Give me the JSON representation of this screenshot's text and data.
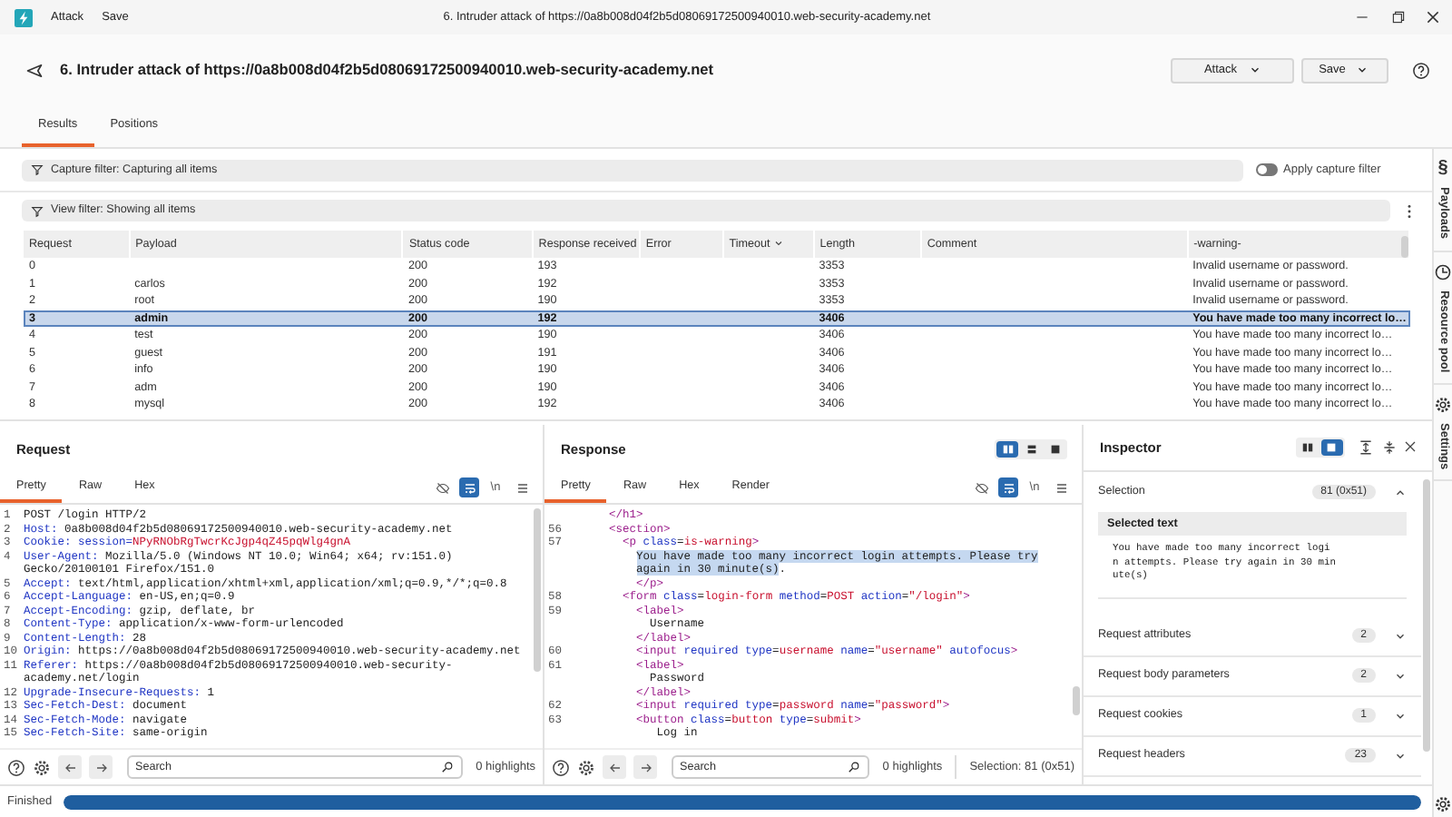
{
  "titlebar": {
    "menu": [
      "Attack",
      "Save"
    ],
    "title": "6. Intruder attack of https://0a8b008d04f2b5d08069172500940010.web-security-academy.net"
  },
  "header": {
    "title": "6. Intruder attack of https://0a8b008d04f2b5d08069172500940010.web-security-academy.net",
    "buttons": [
      "Attack",
      "Save"
    ]
  },
  "tabs": [
    {
      "label": "Results",
      "selected": true
    },
    {
      "label": "Positions",
      "selected": false
    }
  ],
  "capture_filter": {
    "label": "Capture filter: Capturing all items",
    "toggle_label": "Apply capture filter",
    "on": false
  },
  "view_filter": {
    "label": "View filter: Showing all items"
  },
  "table": {
    "columns": [
      {
        "label": "Request",
        "sorted": false
      },
      {
        "label": "Payload",
        "sorted": false
      },
      {
        "label": "Status code",
        "sorted": false
      },
      {
        "label": "Response received",
        "sorted": false
      },
      {
        "label": "Error",
        "sorted": false
      },
      {
        "label": "Timeout",
        "sorted": true
      },
      {
        "label": "Length",
        "sorted": false
      },
      {
        "label": "Comment",
        "sorted": false
      },
      {
        "label": "-warning-",
        "sorted": false
      }
    ],
    "rows": [
      {
        "selected": false,
        "cells": [
          "0",
          "",
          "200",
          "193",
          "",
          "",
          "3353",
          "",
          "Invalid username or password."
        ]
      },
      {
        "selected": false,
        "cells": [
          "1",
          "carlos",
          "200",
          "192",
          "",
          "",
          "3353",
          "",
          "Invalid username or password."
        ]
      },
      {
        "selected": false,
        "cells": [
          "2",
          "root",
          "200",
          "190",
          "",
          "",
          "3353",
          "",
          "Invalid username or password."
        ]
      },
      {
        "selected": true,
        "cells": [
          "3",
          "admin",
          "200",
          "192",
          "",
          "",
          "3406",
          "",
          "You have made too many incorrect lo…"
        ]
      },
      {
        "selected": false,
        "cells": [
          "4",
          "test",
          "200",
          "190",
          "",
          "",
          "3406",
          "",
          "You have made too many incorrect lo…"
        ]
      },
      {
        "selected": false,
        "cells": [
          "5",
          "guest",
          "200",
          "191",
          "",
          "",
          "3406",
          "",
          "You have made too many incorrect lo…"
        ]
      },
      {
        "selected": false,
        "cells": [
          "6",
          "info",
          "200",
          "190",
          "",
          "",
          "3406",
          "",
          "You have made too many incorrect lo…"
        ]
      },
      {
        "selected": false,
        "cells": [
          "7",
          "adm",
          "200",
          "190",
          "",
          "",
          "3406",
          "",
          "You have made too many incorrect lo…"
        ]
      },
      {
        "selected": false,
        "cells": [
          "8",
          "mysql",
          "200",
          "192",
          "",
          "",
          "3406",
          "",
          "You have made too many incorrect lo…"
        ]
      }
    ]
  },
  "request": {
    "title": "Request",
    "tabs": [
      {
        "label": "Pretty",
        "selected": true
      },
      {
        "label": "Raw",
        "selected": false
      },
      {
        "label": "Hex",
        "selected": false
      }
    ],
    "tools": [
      {
        "kind": "hide",
        "selected": false
      },
      {
        "kind": "wrap",
        "selected": true
      },
      {
        "kind": "newline",
        "label": "\\n",
        "selected": false
      },
      {
        "kind": "menu",
        "selected": false
      }
    ],
    "lines": [
      {
        "number": "1",
        "parts": [
          {
            "kind": "plain",
            "text": "POST /login HTTP/2"
          }
        ]
      },
      {
        "number": "2",
        "parts": [
          {
            "kind": "key",
            "text": "Host:"
          },
          {
            "kind": "plain",
            "text": " 0a8b008d04f2b5d08069172500940010.web-security-academy.net"
          }
        ]
      },
      {
        "number": "3",
        "parts": [
          {
            "kind": "key",
            "text": "Cookie: session="
          },
          {
            "kind": "cookie",
            "text": "NPyRNObRgTwcrKcJgp4qZ45pqWlg4gnA"
          }
        ]
      },
      {
        "number": "4",
        "parts": [
          {
            "kind": "key",
            "text": "User-Agent:"
          },
          {
            "kind": "plain",
            "text": " Mozilla/5.0 (Windows NT 10.0; Win64; x64; rv:151.0) Gecko/20100101 Firefox/151.0"
          }
        ]
      },
      {
        "number": "5",
        "parts": [
          {
            "kind": "key",
            "text": "Accept:"
          },
          {
            "kind": "plain",
            "text": " text/html,application/xhtml+xml,application/xml;q=0.9,*/*;q=0.8"
          }
        ]
      },
      {
        "number": "6",
        "parts": [
          {
            "kind": "key",
            "text": "Accept-Language:"
          },
          {
            "kind": "plain",
            "text": " en-US,en;q=0.9"
          }
        ]
      },
      {
        "number": "7",
        "parts": [
          {
            "kind": "key",
            "text": "Accept-Encoding:"
          },
          {
            "kind": "plain",
            "text": " gzip, deflate, br"
          }
        ]
      },
      {
        "number": "8",
        "parts": [
          {
            "kind": "key",
            "text": "Content-Type:"
          },
          {
            "kind": "plain",
            "text": " application/x-www-form-urlencoded"
          }
        ]
      },
      {
        "number": "9",
        "parts": [
          {
            "kind": "key",
            "text": "Content-Length:"
          },
          {
            "kind": "plain",
            "text": " 28"
          }
        ]
      },
      {
        "number": "10",
        "parts": [
          {
            "kind": "key",
            "text": "Origin:"
          },
          {
            "kind": "plain",
            "text": " https://0a8b008d04f2b5d08069172500940010.web-security-academy.net"
          }
        ]
      },
      {
        "number": "11",
        "parts": [
          {
            "kind": "key",
            "text": "Referer:"
          },
          {
            "kind": "plain",
            "text": " https://0a8b008d04f2b5d08069172500940010.web-security-academy.net/login"
          }
        ]
      },
      {
        "number": "12",
        "parts": [
          {
            "kind": "key",
            "text": "Upgrade-Insecure-Requests:"
          },
          {
            "kind": "plain",
            "text": " 1"
          }
        ]
      },
      {
        "number": "13",
        "parts": [
          {
            "kind": "key",
            "text": "Sec-Fetch-Dest:"
          },
          {
            "kind": "plain",
            "text": " document"
          }
        ]
      },
      {
        "number": "14",
        "parts": [
          {
            "kind": "key",
            "text": "Sec-Fetch-Mode:"
          },
          {
            "kind": "plain",
            "text": " navigate"
          }
        ]
      },
      {
        "number": "15",
        "parts": [
          {
            "kind": "key",
            "text": "Sec-Fetch-Site:"
          },
          {
            "kind": "plain",
            "text": " same-origin"
          }
        ]
      }
    ],
    "search": {
      "placeholder": "Search"
    },
    "highlights": "0 highlights"
  },
  "response": {
    "title": "Response",
    "tabs": [
      {
        "label": "Pretty",
        "selected": true
      },
      {
        "label": "Raw",
        "selected": false
      },
      {
        "label": "Hex",
        "selected": false
      },
      {
        "label": "Render",
        "selected": false
      }
    ],
    "views": [
      {
        "kind": "split",
        "selected": true
      },
      {
        "kind": "rows",
        "selected": false
      },
      {
        "kind": "single",
        "selected": false
      }
    ],
    "tools": [
      {
        "kind": "hide",
        "selected": false
      },
      {
        "kind": "wrap",
        "selected": true
      },
      {
        "kind": "newline",
        "label": "\\n",
        "selected": false
      },
      {
        "kind": "menu",
        "selected": false
      }
    ],
    "lines": [
      {
        "parts": [
          {
            "kind": "tag",
            "text": "      </h1>"
          }
        ]
      },
      {
        "number": "56",
        "parts": [
          {
            "kind": "tag",
            "text": "      <section>"
          }
        ]
      },
      {
        "number": "57",
        "parts": [
          {
            "kind": "tag",
            "text": "        <p "
          },
          {
            "kind": "attr",
            "text": "class"
          },
          {
            "kind": "plain",
            "text": "="
          },
          {
            "kind": "value",
            "text": "is-warning"
          },
          {
            "kind": "tag",
            "text": ">"
          }
        ]
      },
      {
        "parts": [
          {
            "kind": "selection",
            "text": "          You have made too many incorrect login attempts. Please try"
          }
        ]
      },
      {
        "parts": [
          {
            "kind": "selection",
            "text": "          again in 30 minute(s)"
          },
          {
            "kind": "plain",
            "text": "."
          }
        ]
      },
      {
        "parts": [
          {
            "kind": "tag",
            "text": "          </p>"
          }
        ]
      },
      {
        "number": "58",
        "parts": [
          {
            "kind": "tag",
            "text": "        <form "
          },
          {
            "kind": "attr",
            "text": "class"
          },
          {
            "kind": "plain",
            "text": "="
          },
          {
            "kind": "value",
            "text": "login-form"
          },
          {
            "kind": "attr",
            "text": " method"
          },
          {
            "kind": "plain",
            "text": "="
          },
          {
            "kind": "value",
            "text": "POST"
          },
          {
            "kind": "attr",
            "text": " action"
          },
          {
            "kind": "plain",
            "text": "="
          },
          {
            "kind": "value",
            "text": "\"/login\""
          },
          {
            "kind": "tag",
            "text": ">"
          }
        ]
      },
      {
        "number": "59",
        "parts": [
          {
            "kind": "tag",
            "text": "          <label>"
          }
        ]
      },
      {
        "parts": [
          {
            "kind": "plain",
            "text": "            Username"
          }
        ]
      },
      {
        "parts": [
          {
            "kind": "tag",
            "text": "          </label>"
          }
        ]
      },
      {
        "number": "60",
        "parts": [
          {
            "kind": "tag",
            "text": "          <input "
          },
          {
            "kind": "attr",
            "text": "required type"
          },
          {
            "kind": "plain",
            "text": "="
          },
          {
            "kind": "value",
            "text": "username"
          },
          {
            "kind": "attr",
            "text": " name"
          },
          {
            "kind": "plain",
            "text": "="
          },
          {
            "kind": "value",
            "text": "\"username\""
          },
          {
            "kind": "attr",
            "text": " autofocus"
          },
          {
            "kind": "tag",
            "text": ">"
          }
        ]
      },
      {
        "number": "61",
        "parts": [
          {
            "kind": "tag",
            "text": "          <label>"
          }
        ]
      },
      {
        "parts": [
          {
            "kind": "plain",
            "text": "            Password"
          }
        ]
      },
      {
        "parts": [
          {
            "kind": "tag",
            "text": "          </label>"
          }
        ]
      },
      {
        "number": "62",
        "parts": [
          {
            "kind": "tag",
            "text": "          <input "
          },
          {
            "kind": "attr",
            "text": "required type"
          },
          {
            "kind": "plain",
            "text": "="
          },
          {
            "kind": "value",
            "text": "password"
          },
          {
            "kind": "attr",
            "text": " name"
          },
          {
            "kind": "plain",
            "text": "="
          },
          {
            "kind": "value",
            "text": "\"password\""
          },
          {
            "kind": "tag",
            "text": ">"
          }
        ]
      },
      {
        "number": "63",
        "parts": [
          {
            "kind": "tag",
            "text": "          <button "
          },
          {
            "kind": "attr",
            "text": "class"
          },
          {
            "kind": "plain",
            "text": "="
          },
          {
            "kind": "value",
            "text": "button"
          },
          {
            "kind": "attr",
            "text": " type"
          },
          {
            "kind": "plain",
            "text": "="
          },
          {
            "kind": "value",
            "text": "submit"
          },
          {
            "kind": "tag",
            "text": ">"
          }
        ]
      },
      {
        "parts": [
          {
            "kind": "plain",
            "text": "             Log in"
          }
        ]
      }
    ],
    "search": {
      "placeholder": "Search"
    },
    "highlights": "0 highlights",
    "selection": "Selection: 81 (0x51)"
  },
  "inspector": {
    "title": "Inspector",
    "views": [
      {
        "kind": "split",
        "selected": false
      },
      {
        "kind": "single",
        "selected": true
      }
    ],
    "sections": [
      {
        "label": "Selection",
        "count": "81 (0x51)",
        "expanded": true,
        "box_title": "Selected text",
        "box_text": "You have made too many incorrect login attempts. Please try again in 30 minute(s)"
      },
      {
        "label": "Request attributes",
        "count": "2",
        "expanded": false
      },
      {
        "label": "Request body parameters",
        "count": "2",
        "expanded": false
      },
      {
        "label": "Request cookies",
        "count": "1",
        "expanded": false
      },
      {
        "label": "Request headers",
        "count": "23",
        "expanded": false
      }
    ]
  },
  "sidebar": [
    {
      "kind": "payloads",
      "label": "Payloads",
      "glyph": "§"
    },
    {
      "kind": "pool",
      "label": "Resource pool"
    },
    {
      "kind": "settings",
      "label": "Settings"
    }
  ],
  "status": {
    "text": "Finished",
    "level": 1
  }
}
